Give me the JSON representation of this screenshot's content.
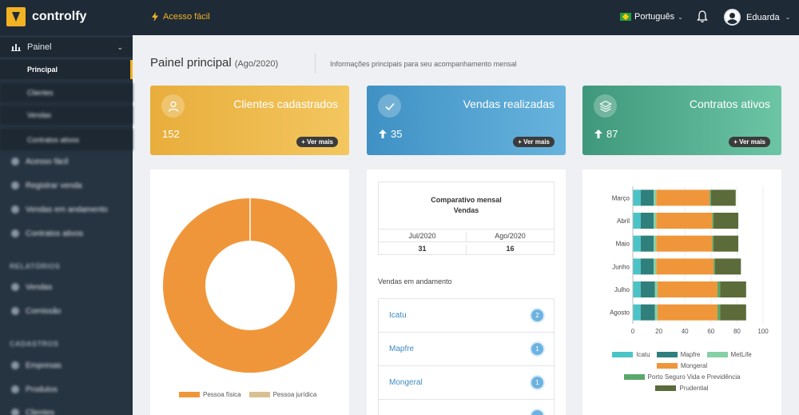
{
  "topbar": {
    "brand": "controlfy",
    "quick_access": "Acesso fácil",
    "language": "Português",
    "user_name": "Eduarda"
  },
  "sidebar": {
    "panel_label": "Painel",
    "sub_items": [
      "Principal",
      "Clientes",
      "Vendas",
      "Contratos ativos"
    ],
    "main_items": [
      "Acesso fácil",
      "Registrar venda",
      "Vendas em andamento",
      "Contratos ativos"
    ],
    "section_reports": "RELATÓRIOS",
    "report_items": [
      "Vendas",
      "Comissão"
    ],
    "section_registers": "CADASTROS",
    "register_items": [
      "Empresas",
      "Produtos",
      "Clientes"
    ]
  },
  "page": {
    "title": "Painel principal",
    "period": "(Ago/2020)",
    "description": "Informações principais para seu acompanhamento mensal"
  },
  "kpis": [
    {
      "label": "Clientes cadastrados",
      "value": "152",
      "more": "+ Ver mais",
      "icon": "user-icon"
    },
    {
      "label": "Vendas realizadas",
      "value": "35",
      "more": "+ Ver mais",
      "icon": "check-icon"
    },
    {
      "label": "Contratos ativos",
      "value": "87",
      "more": "+ Ver mais",
      "icon": "layers-icon"
    }
  ],
  "comparison": {
    "title": "Comparativo mensal",
    "subtitle": "Vendas",
    "months": [
      "Jul/2020",
      "Ago/2020"
    ],
    "values": [
      "31",
      "16"
    ]
  },
  "vendas_andamento": {
    "title": "Vendas em andamento",
    "items": [
      {
        "name": "Icatu",
        "count": "2"
      },
      {
        "name": "Mapfre",
        "count": "1"
      },
      {
        "name": "Mongeral",
        "count": "1"
      },
      {
        "name": "",
        "count": ""
      }
    ]
  },
  "colors": {
    "pessoa_fisica": "#f0963a",
    "pessoa_juridica": "#d9bf92",
    "icatu": "#4bc4c7",
    "mapfre": "#2f7f7d",
    "metlife": "#86d0a5",
    "mongeral": "#f0963a",
    "porto": "#5aa86b",
    "prudential": "#5b6b3a"
  },
  "chart_data": [
    {
      "type": "pie",
      "labels": [
        "Pessoa física",
        "Pessoa jurídica"
      ],
      "values": [
        100,
        0
      ],
      "donut": true,
      "legend": "bottom"
    },
    {
      "type": "bar",
      "orientation": "horizontal",
      "stacked": true,
      "categories": [
        "Março",
        "Abril",
        "Maio",
        "Junho",
        "Julho",
        "Agosto"
      ],
      "series": [
        {
          "name": "Icatu",
          "values": [
            6,
            6,
            6,
            6,
            6,
            6
          ]
        },
        {
          "name": "Mapfre",
          "values": [
            10,
            10,
            10,
            10,
            11,
            11
          ]
        },
        {
          "name": "MetLife",
          "values": [
            2,
            2,
            2,
            2,
            2,
            2
          ]
        },
        {
          "name": "Mongeral",
          "values": [
            41,
            43,
            43,
            44,
            46,
            46
          ]
        },
        {
          "name": "Porto Seguro Vida e Previdência",
          "values": [
            1,
            1,
            1,
            1,
            2,
            2
          ]
        },
        {
          "name": "Prudential",
          "values": [
            19,
            19,
            19,
            20,
            20,
            20
          ]
        }
      ],
      "xlim": [
        0,
        100
      ],
      "xticks": [
        0,
        20,
        40,
        60,
        80,
        100
      ],
      "grid": true,
      "legend": "bottom"
    }
  ]
}
